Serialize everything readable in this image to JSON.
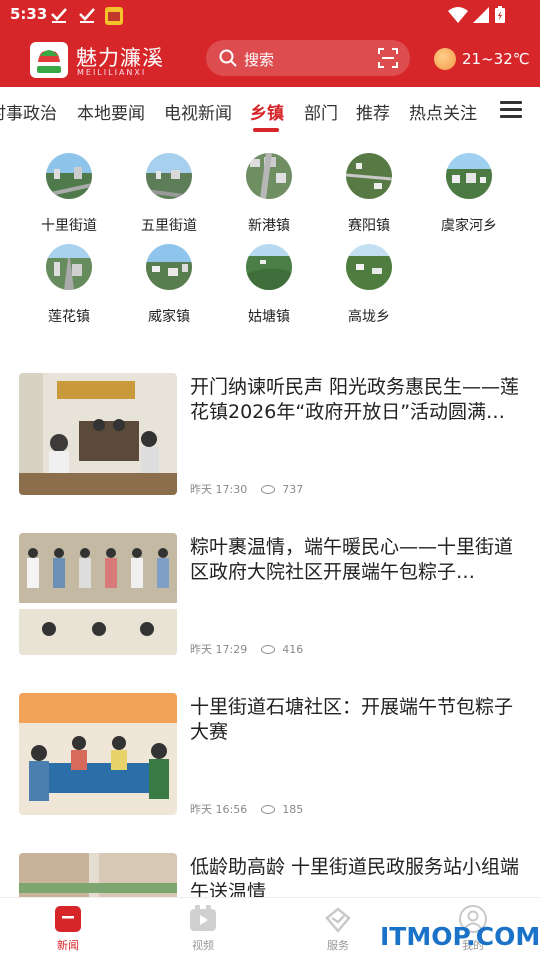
{
  "status_bar": {
    "time": "5:33"
  },
  "header": {
    "app_name": "魅力濂溪",
    "app_name_en": "MEILILIANXI",
    "search_placeholder": "搜索",
    "weather": "21~32℃"
  },
  "tabs": [
    {
      "label": "时事政治"
    },
    {
      "label": "本地要闻"
    },
    {
      "label": "电视新闻"
    },
    {
      "label": "乡镇"
    },
    {
      "label": "部门"
    },
    {
      "label": "推荐"
    },
    {
      "label": "热点关注"
    }
  ],
  "active_tab": "乡镇",
  "towns": [
    {
      "name": "十里街道"
    },
    {
      "name": "五里街道"
    },
    {
      "name": "新港镇"
    },
    {
      "name": "赛阳镇"
    },
    {
      "name": "虞家河乡"
    },
    {
      "name": "莲花镇"
    },
    {
      "name": "威家镇"
    },
    {
      "name": "姑塘镇"
    },
    {
      "name": "高垅乡"
    }
  ],
  "news": [
    {
      "title": "开门纳谏听民声 阳光政务惠民生——莲花镇2026年“政府开放日”活动圆满…",
      "time": "昨天 17:30",
      "views": "737"
    },
    {
      "title": "粽叶裹温情，端午暖民心——十里街道区政府大院社区开展端午包粽子…",
      "time": "昨天 17:29",
      "views": "416"
    },
    {
      "title": "十里街道石塘社区：开展端午节包粽子大赛",
      "time": "昨天 16:56",
      "views": "185"
    },
    {
      "title": "低龄助高龄 十里街道民政服务站小组端午送温情",
      "time": "",
      "views": ""
    }
  ],
  "bottom_nav": [
    {
      "label": "新闻",
      "icon": "news-icon"
    },
    {
      "label": "视频",
      "icon": "video-icon"
    },
    {
      "label": "服务",
      "icon": "service-icon"
    },
    {
      "label": "我的",
      "icon": "profile-icon"
    }
  ],
  "watermark": "ITMOP.COM",
  "colors": {
    "brand_red": "#d6262a",
    "text": "#222222",
    "meta": "#8a8a8a"
  }
}
